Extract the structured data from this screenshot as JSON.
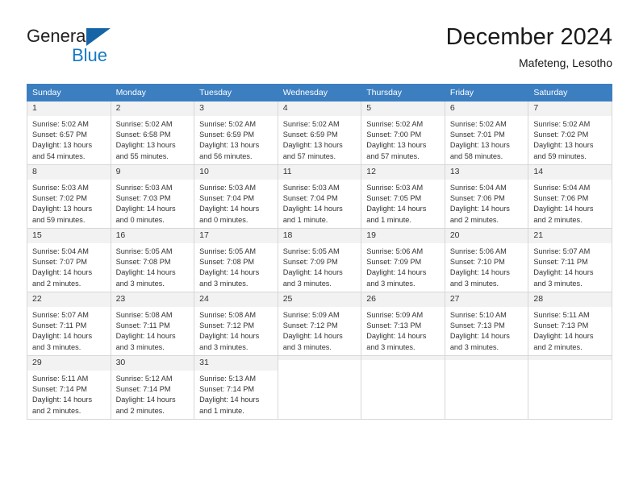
{
  "brand": {
    "name_part1": "General",
    "name_part2": "Blue",
    "accent_color": "#1479c4",
    "triangle_color": "#1565a6"
  },
  "header": {
    "title": "December 2024",
    "subtitle": "Mafeteng, Lesotho"
  },
  "calendar": {
    "header_bg": "#3c7fc1",
    "weekday_headers": [
      "Sunday",
      "Monday",
      "Tuesday",
      "Wednesday",
      "Thursday",
      "Friday",
      "Saturday"
    ],
    "weeks": [
      [
        {
          "day": "1",
          "sunrise": "Sunrise: 5:02 AM",
          "sunset": "Sunset: 6:57 PM",
          "daylight1": "Daylight: 13 hours",
          "daylight2": "and 54 minutes."
        },
        {
          "day": "2",
          "sunrise": "Sunrise: 5:02 AM",
          "sunset": "Sunset: 6:58 PM",
          "daylight1": "Daylight: 13 hours",
          "daylight2": "and 55 minutes."
        },
        {
          "day": "3",
          "sunrise": "Sunrise: 5:02 AM",
          "sunset": "Sunset: 6:59 PM",
          "daylight1": "Daylight: 13 hours",
          "daylight2": "and 56 minutes."
        },
        {
          "day": "4",
          "sunrise": "Sunrise: 5:02 AM",
          "sunset": "Sunset: 6:59 PM",
          "daylight1": "Daylight: 13 hours",
          "daylight2": "and 57 minutes."
        },
        {
          "day": "5",
          "sunrise": "Sunrise: 5:02 AM",
          "sunset": "Sunset: 7:00 PM",
          "daylight1": "Daylight: 13 hours",
          "daylight2": "and 57 minutes."
        },
        {
          "day": "6",
          "sunrise": "Sunrise: 5:02 AM",
          "sunset": "Sunset: 7:01 PM",
          "daylight1": "Daylight: 13 hours",
          "daylight2": "and 58 minutes."
        },
        {
          "day": "7",
          "sunrise": "Sunrise: 5:02 AM",
          "sunset": "Sunset: 7:02 PM",
          "daylight1": "Daylight: 13 hours",
          "daylight2": "and 59 minutes."
        }
      ],
      [
        {
          "day": "8",
          "sunrise": "Sunrise: 5:03 AM",
          "sunset": "Sunset: 7:02 PM",
          "daylight1": "Daylight: 13 hours",
          "daylight2": "and 59 minutes."
        },
        {
          "day": "9",
          "sunrise": "Sunrise: 5:03 AM",
          "sunset": "Sunset: 7:03 PM",
          "daylight1": "Daylight: 14 hours",
          "daylight2": "and 0 minutes."
        },
        {
          "day": "10",
          "sunrise": "Sunrise: 5:03 AM",
          "sunset": "Sunset: 7:04 PM",
          "daylight1": "Daylight: 14 hours",
          "daylight2": "and 0 minutes."
        },
        {
          "day": "11",
          "sunrise": "Sunrise: 5:03 AM",
          "sunset": "Sunset: 7:04 PM",
          "daylight1": "Daylight: 14 hours",
          "daylight2": "and 1 minute."
        },
        {
          "day": "12",
          "sunrise": "Sunrise: 5:03 AM",
          "sunset": "Sunset: 7:05 PM",
          "daylight1": "Daylight: 14 hours",
          "daylight2": "and 1 minute."
        },
        {
          "day": "13",
          "sunrise": "Sunrise: 5:04 AM",
          "sunset": "Sunset: 7:06 PM",
          "daylight1": "Daylight: 14 hours",
          "daylight2": "and 2 minutes."
        },
        {
          "day": "14",
          "sunrise": "Sunrise: 5:04 AM",
          "sunset": "Sunset: 7:06 PM",
          "daylight1": "Daylight: 14 hours",
          "daylight2": "and 2 minutes."
        }
      ],
      [
        {
          "day": "15",
          "sunrise": "Sunrise: 5:04 AM",
          "sunset": "Sunset: 7:07 PM",
          "daylight1": "Daylight: 14 hours",
          "daylight2": "and 2 minutes."
        },
        {
          "day": "16",
          "sunrise": "Sunrise: 5:05 AM",
          "sunset": "Sunset: 7:08 PM",
          "daylight1": "Daylight: 14 hours",
          "daylight2": "and 3 minutes."
        },
        {
          "day": "17",
          "sunrise": "Sunrise: 5:05 AM",
          "sunset": "Sunset: 7:08 PM",
          "daylight1": "Daylight: 14 hours",
          "daylight2": "and 3 minutes."
        },
        {
          "day": "18",
          "sunrise": "Sunrise: 5:05 AM",
          "sunset": "Sunset: 7:09 PM",
          "daylight1": "Daylight: 14 hours",
          "daylight2": "and 3 minutes."
        },
        {
          "day": "19",
          "sunrise": "Sunrise: 5:06 AM",
          "sunset": "Sunset: 7:09 PM",
          "daylight1": "Daylight: 14 hours",
          "daylight2": "and 3 minutes."
        },
        {
          "day": "20",
          "sunrise": "Sunrise: 5:06 AM",
          "sunset": "Sunset: 7:10 PM",
          "daylight1": "Daylight: 14 hours",
          "daylight2": "and 3 minutes."
        },
        {
          "day": "21",
          "sunrise": "Sunrise: 5:07 AM",
          "sunset": "Sunset: 7:11 PM",
          "daylight1": "Daylight: 14 hours",
          "daylight2": "and 3 minutes."
        }
      ],
      [
        {
          "day": "22",
          "sunrise": "Sunrise: 5:07 AM",
          "sunset": "Sunset: 7:11 PM",
          "daylight1": "Daylight: 14 hours",
          "daylight2": "and 3 minutes."
        },
        {
          "day": "23",
          "sunrise": "Sunrise: 5:08 AM",
          "sunset": "Sunset: 7:11 PM",
          "daylight1": "Daylight: 14 hours",
          "daylight2": "and 3 minutes."
        },
        {
          "day": "24",
          "sunrise": "Sunrise: 5:08 AM",
          "sunset": "Sunset: 7:12 PM",
          "daylight1": "Daylight: 14 hours",
          "daylight2": "and 3 minutes."
        },
        {
          "day": "25",
          "sunrise": "Sunrise: 5:09 AM",
          "sunset": "Sunset: 7:12 PM",
          "daylight1": "Daylight: 14 hours",
          "daylight2": "and 3 minutes."
        },
        {
          "day": "26",
          "sunrise": "Sunrise: 5:09 AM",
          "sunset": "Sunset: 7:13 PM",
          "daylight1": "Daylight: 14 hours",
          "daylight2": "and 3 minutes."
        },
        {
          "day": "27",
          "sunrise": "Sunrise: 5:10 AM",
          "sunset": "Sunset: 7:13 PM",
          "daylight1": "Daylight: 14 hours",
          "daylight2": "and 3 minutes."
        },
        {
          "day": "28",
          "sunrise": "Sunrise: 5:11 AM",
          "sunset": "Sunset: 7:13 PM",
          "daylight1": "Daylight: 14 hours",
          "daylight2": "and 2 minutes."
        }
      ],
      [
        {
          "day": "29",
          "sunrise": "Sunrise: 5:11 AM",
          "sunset": "Sunset: 7:14 PM",
          "daylight1": "Daylight: 14 hours",
          "daylight2": "and 2 minutes."
        },
        {
          "day": "30",
          "sunrise": "Sunrise: 5:12 AM",
          "sunset": "Sunset: 7:14 PM",
          "daylight1": "Daylight: 14 hours",
          "daylight2": "and 2 minutes."
        },
        {
          "day": "31",
          "sunrise": "Sunrise: 5:13 AM",
          "sunset": "Sunset: 7:14 PM",
          "daylight1": "Daylight: 14 hours",
          "daylight2": "and 1 minute."
        },
        {
          "day": "",
          "sunrise": "",
          "sunset": "",
          "daylight1": "",
          "daylight2": ""
        },
        {
          "day": "",
          "sunrise": "",
          "sunset": "",
          "daylight1": "",
          "daylight2": ""
        },
        {
          "day": "",
          "sunrise": "",
          "sunset": "",
          "daylight1": "",
          "daylight2": ""
        },
        {
          "day": "",
          "sunrise": "",
          "sunset": "",
          "daylight1": "",
          "daylight2": ""
        }
      ]
    ]
  }
}
